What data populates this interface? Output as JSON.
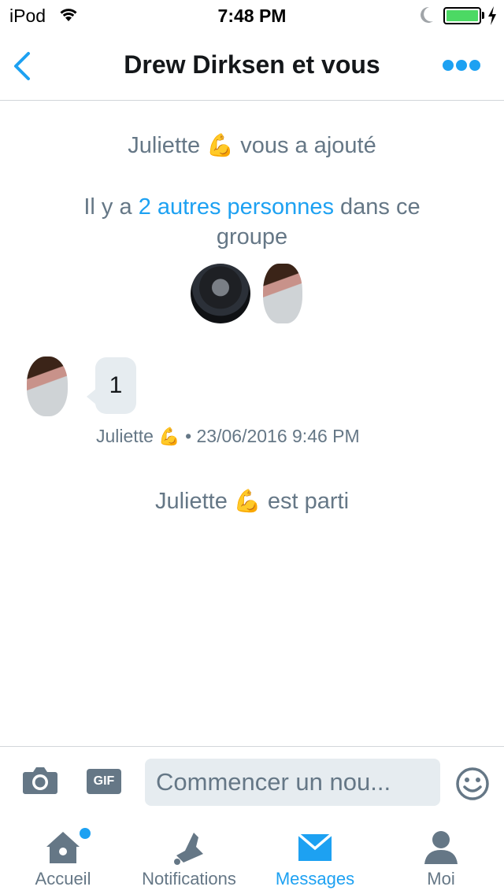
{
  "status_bar": {
    "carrier": "iPod",
    "time": "7:48 PM",
    "battery_level": 1.0
  },
  "nav": {
    "title": "Drew Dirksen et vous"
  },
  "conversation": {
    "added_by": {
      "name": "Juliette",
      "emoji": "💪",
      "text": "vous a ajouté"
    },
    "group_info": {
      "prefix": "Il y a",
      "link": "2 autres personnes",
      "suffix": "dans ce groupe"
    },
    "message": {
      "text": "1",
      "sender": "Juliette",
      "emoji": "💪",
      "separator": "•",
      "timestamp": "23/06/2016 9:46 PM"
    },
    "left": {
      "name": "Juliette",
      "emoji": "💪",
      "text": "est parti"
    }
  },
  "composer": {
    "gif_label": "GIF",
    "placeholder": "Commencer un nou..."
  },
  "tabs": [
    {
      "label": "Accueil",
      "icon": "home-icon",
      "active": false,
      "badge": true
    },
    {
      "label": "Notifications",
      "icon": "bell-icon",
      "active": false
    },
    {
      "label": "Messages",
      "icon": "envelope-icon",
      "active": true
    },
    {
      "label": "Moi",
      "icon": "person-icon",
      "active": false
    }
  ],
  "colors": {
    "accent": "#1da1f2",
    "secondary_text": "#657786",
    "bubble": "#e6ecf0",
    "battery": "#4cd964"
  }
}
